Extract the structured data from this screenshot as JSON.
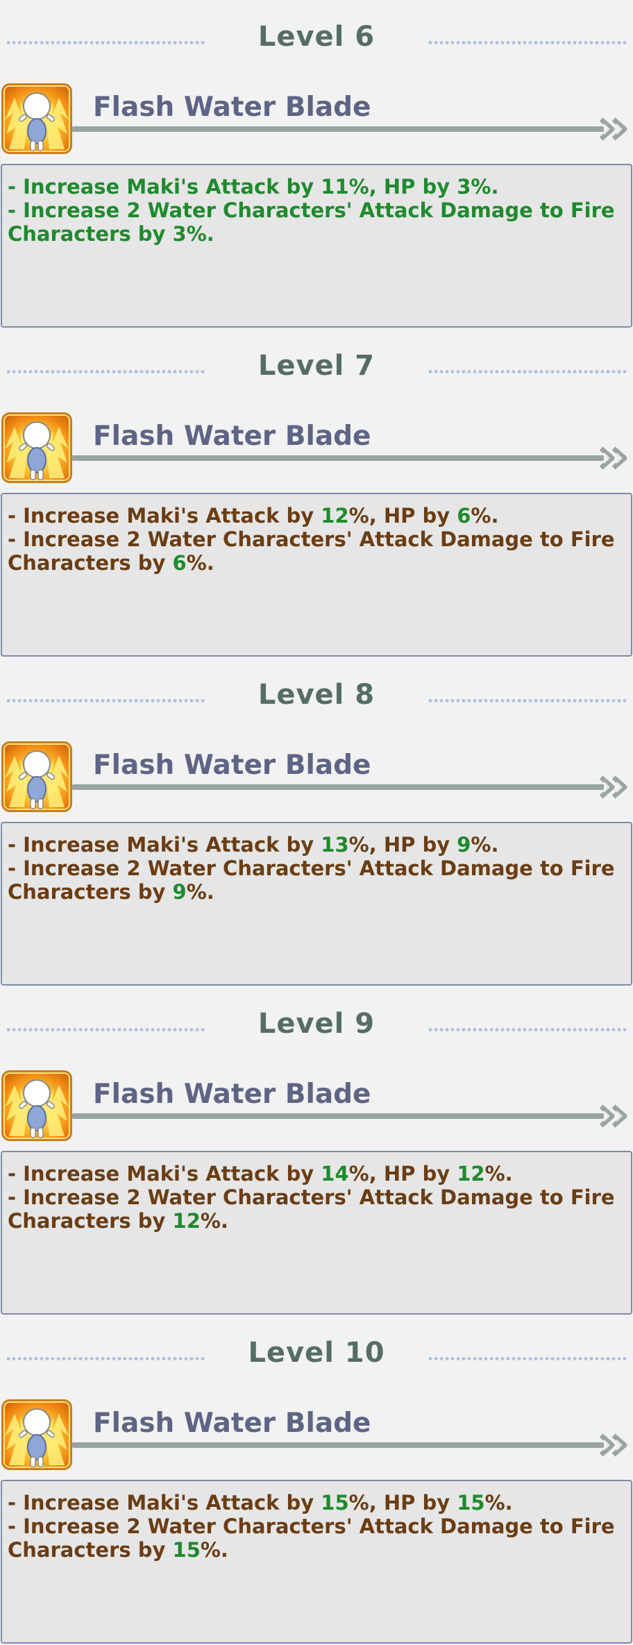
{
  "skill_name": "Flash Water Blade",
  "colors": {
    "title": "#566d67",
    "skill_name": "#5e6485",
    "text_brown": "#6b3d14",
    "value_green": "#1f8a2e",
    "border": "#808aa8",
    "dots": "#aebfe0"
  },
  "icon": "chibi-character-icon",
  "levels": [
    {
      "title": "Level 6",
      "all_green": true,
      "attack": "11",
      "hp": "3",
      "damage": "3",
      "line1_a": "- Increase Maki's Attack by ",
      "line1_b": "%, HP by ",
      "line1_c": "%.",
      "line2": "- Increase 2 Water Characters' Attack Damage to Fire",
      "line3_a": "Characters by ",
      "line3_b": "%."
    },
    {
      "title": "Level 7",
      "all_green": false,
      "attack": "12",
      "hp": "6",
      "damage": "6",
      "line1_a": "- Increase Maki's Attack by ",
      "line1_b": "%,  HP by ",
      "line1_c": "%.",
      "line2": "- Increase 2 Water Characters' Attack Damage to Fire",
      "line3_a": "Characters by ",
      "line3_b": "%."
    },
    {
      "title": "Level 8",
      "all_green": false,
      "attack": "13",
      "hp": "9",
      "damage": "9",
      "line1_a": "- Increase Maki's Attack by ",
      "line1_b": "%,  HP by ",
      "line1_c": "%.",
      "line2": "- Increase 2 Water Characters' Attack Damage to Fire",
      "line3_a": "Characters by ",
      "line3_b": "%."
    },
    {
      "title": "Level 9",
      "all_green": false,
      "attack": "14",
      "hp": "12",
      "damage": "12",
      "line1_a": "- Increase Maki's Attack by ",
      "line1_b": "%,  HP by ",
      "line1_c": "%.",
      "line2": "- Increase 2 Water Characters' Attack Damage to Fire",
      "line3_a": "Characters by ",
      "line3_b": "%."
    },
    {
      "title": "Level 10",
      "all_green": false,
      "attack": "15",
      "hp": "15",
      "damage": "15",
      "line1_a": "- Increase Maki's Attack by ",
      "line1_b": "%,  HP by ",
      "line1_c": "%.",
      "line2": "- Increase 2 Water Characters' Attack Damage to Fire",
      "line3_a": "Characters by ",
      "line3_b": "%."
    }
  ]
}
